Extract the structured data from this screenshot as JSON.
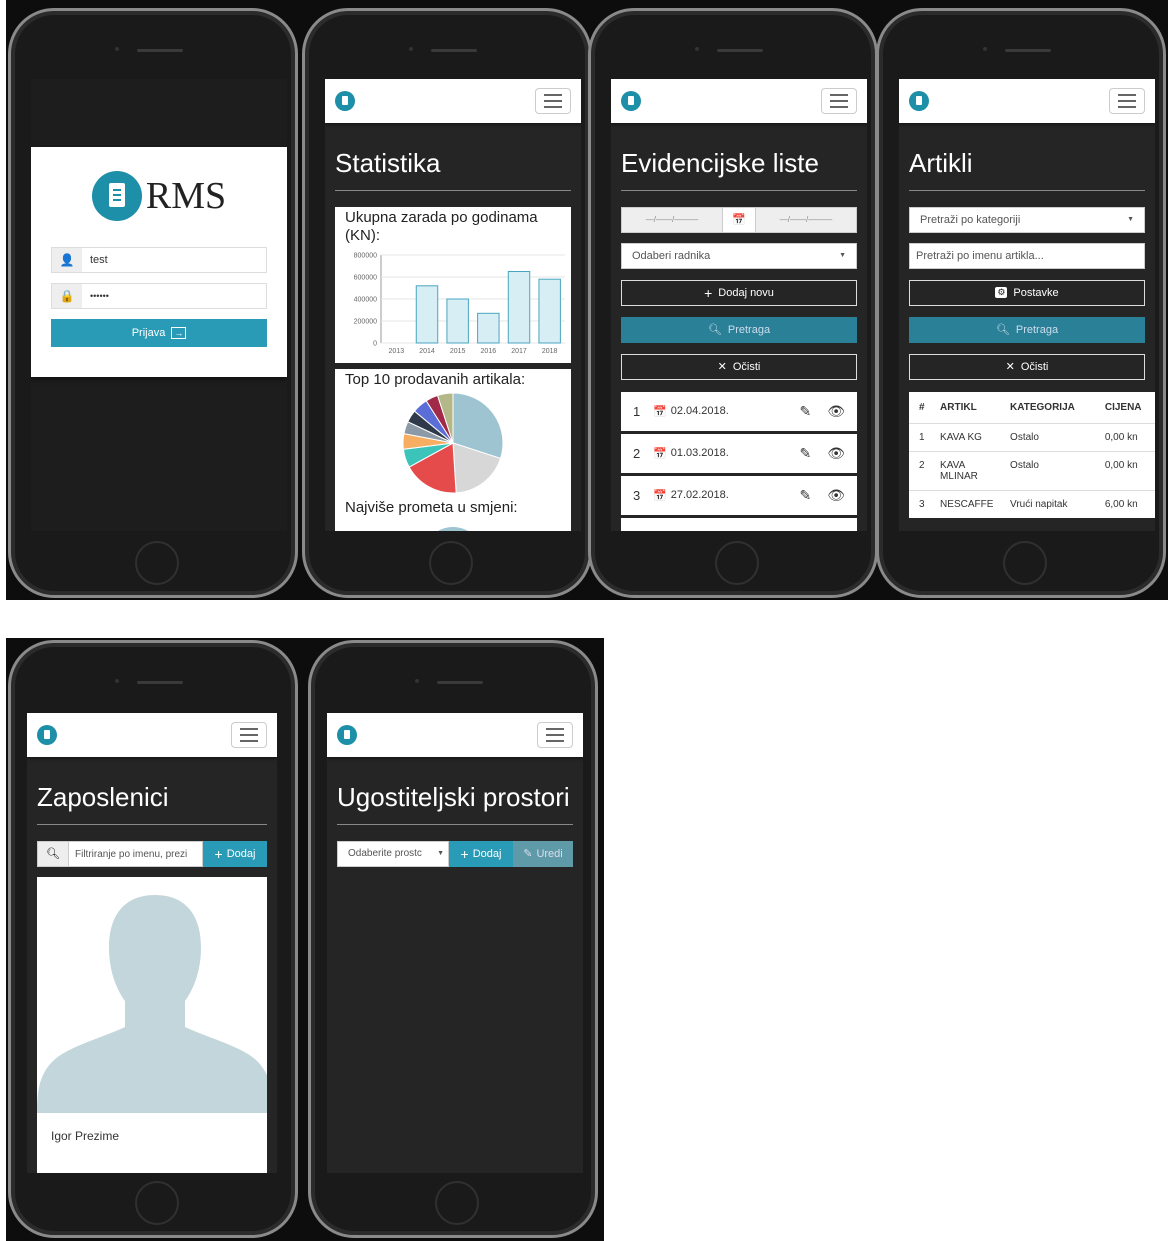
{
  "login": {
    "logo_text": "RMS",
    "username_value": "test",
    "password_value": "••••••",
    "submit_label": "Prijava"
  },
  "stats": {
    "page_title": "Statistika",
    "chart1_title": "Ukupna zarada po godinama (KN):",
    "chart2_title": "Top 10 prodavanih artikala:",
    "chart3_title": "Najviše prometa u smjeni:"
  },
  "chart_data": [
    {
      "type": "bar",
      "title": "Ukupna zarada po godinama (KN):",
      "categories": [
        "2013",
        "2014",
        "2015",
        "2016",
        "2017",
        "2018"
      ],
      "values": [
        0,
        520000,
        400000,
        270000,
        650000,
        580000
      ],
      "yticks": [
        "0",
        "200000",
        "400000",
        "600000",
        "800000"
      ],
      "ylim": [
        0,
        800000
      ],
      "colors": {
        "fill": "#d6eef4",
        "stroke": "#4aa6c0"
      }
    },
    {
      "type": "pie",
      "title": "Top 10 prodavanih artikala:",
      "values": [
        30,
        19,
        18,
        6,
        5,
        4,
        4,
        5,
        4,
        5
      ],
      "colors": [
        "#9ec3d1",
        "#d7d7d7",
        "#e64b4b",
        "#3cc4bb",
        "#f7ae63",
        "#8c9aa8",
        "#2e3a4a",
        "#5b6dd6",
        "#a22a49",
        "#b4b889"
      ]
    }
  ],
  "evidence": {
    "page_title": "Evidencijske liste",
    "date_from_placeholder": "—/——/———",
    "date_to_placeholder": "—/——/———",
    "worker_select": "Odaberi radnika",
    "add_label": "Dodaj novu",
    "search_label": "Pretraga",
    "clear_label": "Očisti",
    "items": [
      {
        "num": "1",
        "date": "02.04.2018."
      },
      {
        "num": "2",
        "date": "01.03.2018."
      },
      {
        "num": "3",
        "date": "27.02.2018."
      }
    ]
  },
  "articles": {
    "page_title": "Artikli",
    "category_select": "Pretraži po kategoriji",
    "name_placeholder": "Pretraži po imenu artikla...",
    "settings_label": "Postavke",
    "search_label": "Pretraga",
    "clear_label": "Očisti",
    "headers": [
      "#",
      "ARTIKL",
      "KATEGORIJA",
      "CIJENA"
    ],
    "rows": [
      {
        "num": "1",
        "name": "KAVA KG",
        "category": "Ostalo",
        "price": "0,00 kn"
      },
      {
        "num": "2",
        "name": "KAVA MLINAR",
        "category": "Ostalo",
        "price": "0,00 kn"
      },
      {
        "num": "3",
        "name": "NESCAFFE",
        "category": "Vrući napitak",
        "price": "6,00 kn"
      }
    ]
  },
  "employees": {
    "page_title": "Zaposlenici",
    "filter_placeholder": "Filtriranje po imenu, prezi",
    "add_label": "Dodaj",
    "card_name": "Igor Prezime"
  },
  "venues": {
    "page_title": "Ugostiteljski prostori",
    "select_label": "Odaberite prostc",
    "add_label": "Dodaj",
    "edit_label": "Uredi"
  }
}
